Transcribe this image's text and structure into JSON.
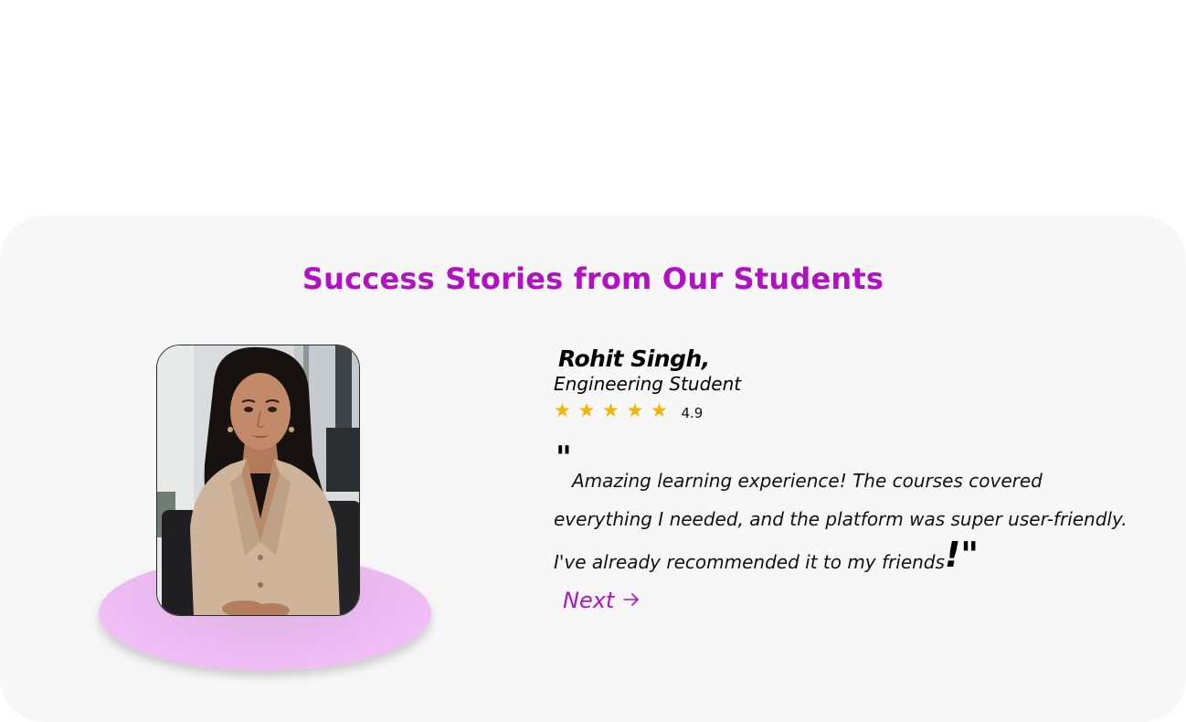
{
  "section": {
    "title": "Success Stories from Our Students"
  },
  "testimonial": {
    "name": "Rohit Singh,",
    "role": "Engineering Student",
    "rating": {
      "stars": 5,
      "value": "4.9",
      "star_color": "#f5b301"
    },
    "quote_open": "\"",
    "quote_text": "Amazing learning experience! The courses covered everything I needed, and the platform was super user-friendly. I've already recommended it to my friends",
    "quote_close": "!\""
  },
  "navigation": {
    "next_label": "Next",
    "next_icon": "arrow-right-icon"
  },
  "colors": {
    "accent": "#b012c1",
    "section_bg": "#f7f7f7",
    "pedestal": "#f3c2f7"
  }
}
